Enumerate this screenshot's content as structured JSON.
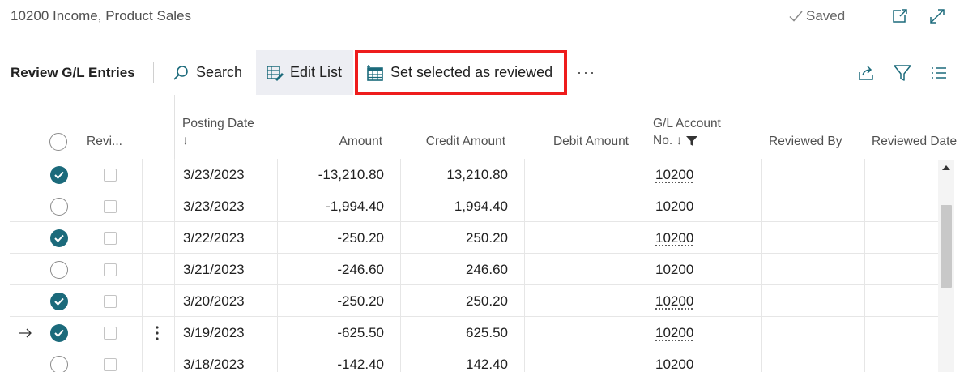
{
  "header": {
    "page_title": "10200 Income, Product Sales",
    "saved_label": "Saved"
  },
  "toolbar": {
    "action_title": "Review G/L Entries",
    "search_label": "Search",
    "edit_list_label": "Edit List",
    "set_reviewed_label": "Set selected as reviewed",
    "more_label": "···"
  },
  "columns": {
    "reviewed": "Revi...",
    "posting_date_line1": "Posting Date",
    "posting_date_line2": "↓",
    "amount": "Amount",
    "credit_amount": "Credit Amount",
    "debit_amount": "Debit Amount",
    "gl_account_line1": "G/L Account",
    "gl_account_line2": "No. ↓",
    "reviewed_by": "Reviewed By",
    "reviewed_date": "Reviewed Date"
  },
  "rows": [
    {
      "selected": true,
      "posting_date": "3/23/2023",
      "amount": "-13,210.80",
      "credit_amount": "13,210.80",
      "gl_account": "10200",
      "link": true,
      "current": false
    },
    {
      "selected": false,
      "posting_date": "3/23/2023",
      "amount": "-1,994.40",
      "credit_amount": "1,994.40",
      "gl_account": "10200",
      "link": false,
      "current": false
    },
    {
      "selected": true,
      "posting_date": "3/22/2023",
      "amount": "-250.20",
      "credit_amount": "250.20",
      "gl_account": "10200",
      "link": true,
      "current": false
    },
    {
      "selected": false,
      "posting_date": "3/21/2023",
      "amount": "-246.60",
      "credit_amount": "246.60",
      "gl_account": "10200",
      "link": false,
      "current": false
    },
    {
      "selected": true,
      "posting_date": "3/20/2023",
      "amount": "-250.20",
      "credit_amount": "250.20",
      "gl_account": "10200",
      "link": true,
      "current": false
    },
    {
      "selected": true,
      "posting_date": "3/19/2023",
      "amount": "-625.50",
      "credit_amount": "625.50",
      "gl_account": "10200",
      "link": true,
      "current": true
    },
    {
      "selected": false,
      "posting_date": "3/18/2023",
      "amount": "-142.40",
      "credit_amount": "142.40",
      "gl_account": "10200",
      "link": false,
      "current": false
    }
  ],
  "colors": {
    "highlight_border": "#ee1c1c",
    "check_fill": "#1b6a7b",
    "edit_list_bg": "#edeef3"
  },
  "icons": {
    "saved": "checkmark-icon",
    "open_new_window": "open-in-new-window-icon",
    "expand": "expand-icon",
    "search": "search-icon",
    "edit_list": "edit-list-icon",
    "set_reviewed": "spreadsheet-icon",
    "share": "share-icon",
    "filter": "filter-icon",
    "list_view": "list-view-icon"
  }
}
